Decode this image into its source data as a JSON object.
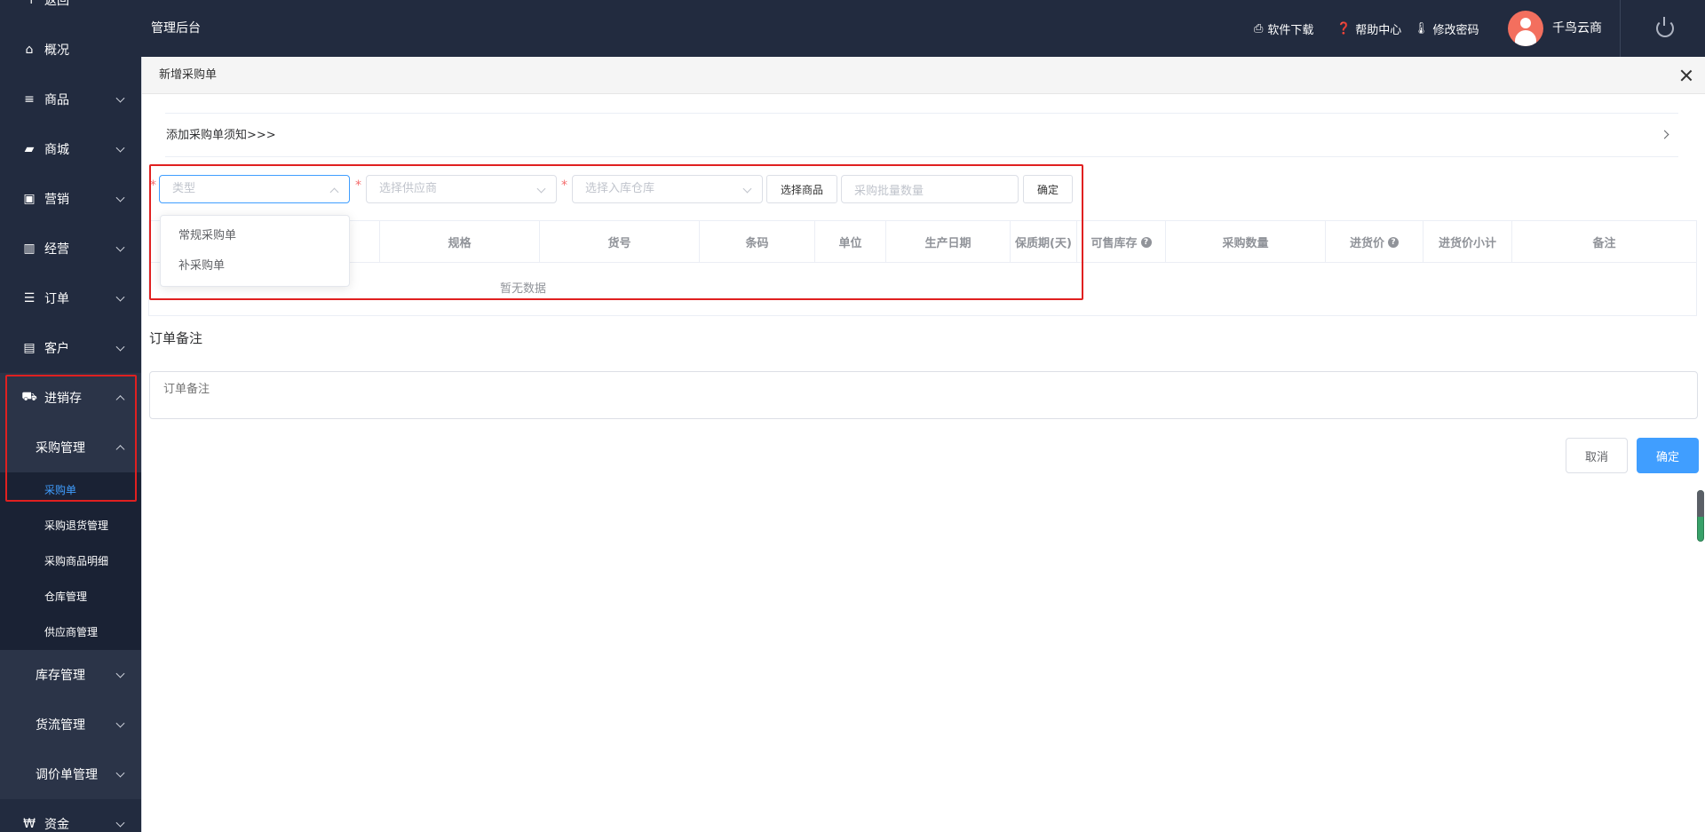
{
  "sidebar": {
    "back_label": "返回",
    "items": [
      {
        "label": "概况",
        "icon": "home-icon"
      },
      {
        "label": "商品",
        "icon": "list-icon"
      },
      {
        "label": "商城",
        "icon": "bag-icon"
      },
      {
        "label": "营销",
        "icon": "gift-icon"
      },
      {
        "label": "经营",
        "icon": "bar-chart-icon"
      },
      {
        "label": "订单",
        "icon": "order-list-icon"
      },
      {
        "label": "客户",
        "icon": "id-card-icon"
      },
      {
        "label": "进销存",
        "icon": "truck-icon"
      },
      {
        "label": "资金",
        "icon": "won-icon"
      }
    ],
    "purchase_group": {
      "label": "采购管理",
      "items": [
        "采购单",
        "采购退货管理",
        "采购商品明细",
        "仓库管理",
        "供应商管理"
      ]
    },
    "groups": [
      "库存管理",
      "货流管理",
      "调价单管理"
    ]
  },
  "header": {
    "title": "管理后台",
    "links": [
      {
        "label": "软件下载",
        "icon": "printer-icon"
      },
      {
        "label": "帮助中心",
        "icon": "help-icon"
      },
      {
        "label": "修改密码",
        "icon": "thermometer-icon"
      }
    ],
    "user_name": "千鸟云商"
  },
  "dialog": {
    "title": "新增采购单",
    "notice": "添加采购单须知>>>",
    "form": {
      "type_placeholder": "类型",
      "supplier_placeholder": "选择供应商",
      "warehouse_placeholder": "选择入库仓库",
      "select_goods_label": "选择商品",
      "batch_qty_placeholder": "采购批量数量",
      "confirm_label": "确定",
      "required_mark": "*"
    },
    "type_options": [
      "常规采购单",
      "补采购单"
    ],
    "table": {
      "columns": [
        "规格",
        "货号",
        "条码",
        "单位",
        "生产日期",
        "保质期(天)",
        "可售库存",
        "采购数量",
        "进货价",
        "进货价小计",
        "备注"
      ],
      "help_mark": "?",
      "empty_text": "暂无数据"
    },
    "remark": {
      "title": "订单备注",
      "placeholder": "订单备注"
    },
    "cancel_label": "取消",
    "ok_label": "确定"
  },
  "colors": {
    "sidebar_bg": "#222b3f",
    "accent": "#409eff",
    "highlight_box": "#e02020",
    "avatar": "#f36f5e"
  }
}
